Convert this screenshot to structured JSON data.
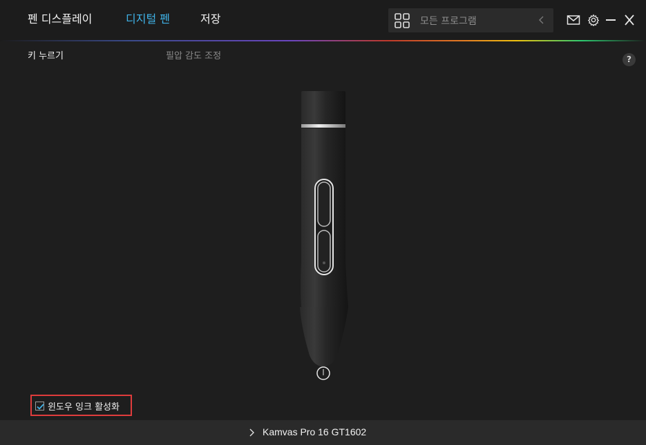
{
  "header": {
    "tabs": [
      {
        "label": "펜 디스플레이",
        "active": false
      },
      {
        "label": "디지털 펜",
        "active": true
      },
      {
        "label": "저장",
        "active": false
      }
    ],
    "search": {
      "placeholder": "모든 프로그램",
      "icon": "grid-icon"
    },
    "window_controls": [
      "mail-icon",
      "gear-icon",
      "minimize-icon",
      "close-icon"
    ]
  },
  "subnav": {
    "tabs": [
      {
        "label": "키 누르기",
        "active": true
      },
      {
        "label": "필압 감도 조정",
        "active": false
      }
    ],
    "help_label": "?"
  },
  "options": {
    "windows_ink": {
      "label": "윈도우 잉크 활성화",
      "checked": true
    }
  },
  "footer": {
    "device_name": "Kamvas Pro 16 GT1602"
  },
  "colors": {
    "accent": "#3fb3e8",
    "highlight_border": "#e03c3c",
    "background": "#1e1e1e"
  }
}
